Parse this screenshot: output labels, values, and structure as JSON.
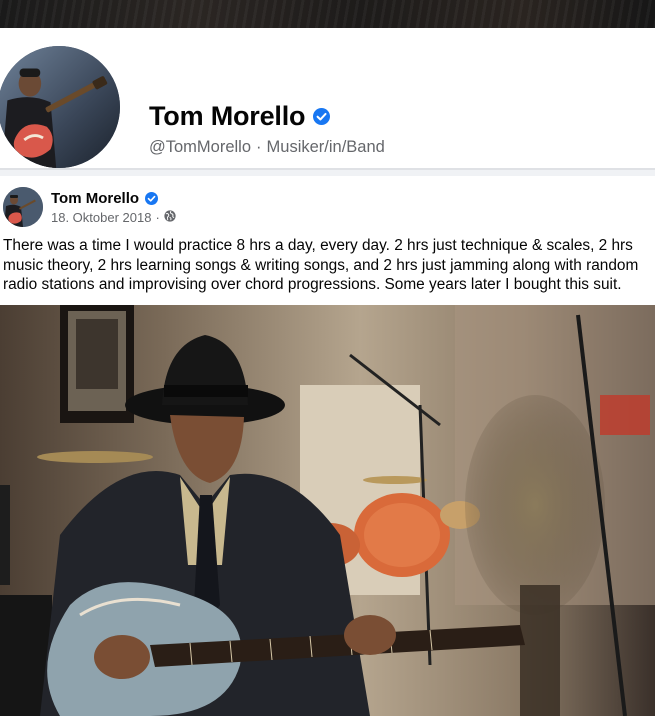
{
  "profile": {
    "name": "Tom Morello",
    "handle": "@TomMorello",
    "separator": "·",
    "category": "Musiker/in/Band"
  },
  "post": {
    "author": "Tom Morello",
    "date": "18. Oktober 2018",
    "meta_separator": "·",
    "audience_icon": "globe-icon",
    "text": "There was a time I would practice 8 hrs a day, every day. 2 hrs just technique & scales, 2 hrs music theory, 2 hrs learning songs & writing songs, and 2 hrs just jamming along with random radio stations and improvising over chord progressions. Some years later I bought this suit."
  },
  "icons": {
    "verified": "verified-badge-icon",
    "audience": "globe-icon"
  },
  "colors": {
    "verified_blue": "#1877f2",
    "secondary_text": "#65676b",
    "primary_text": "#050505"
  }
}
